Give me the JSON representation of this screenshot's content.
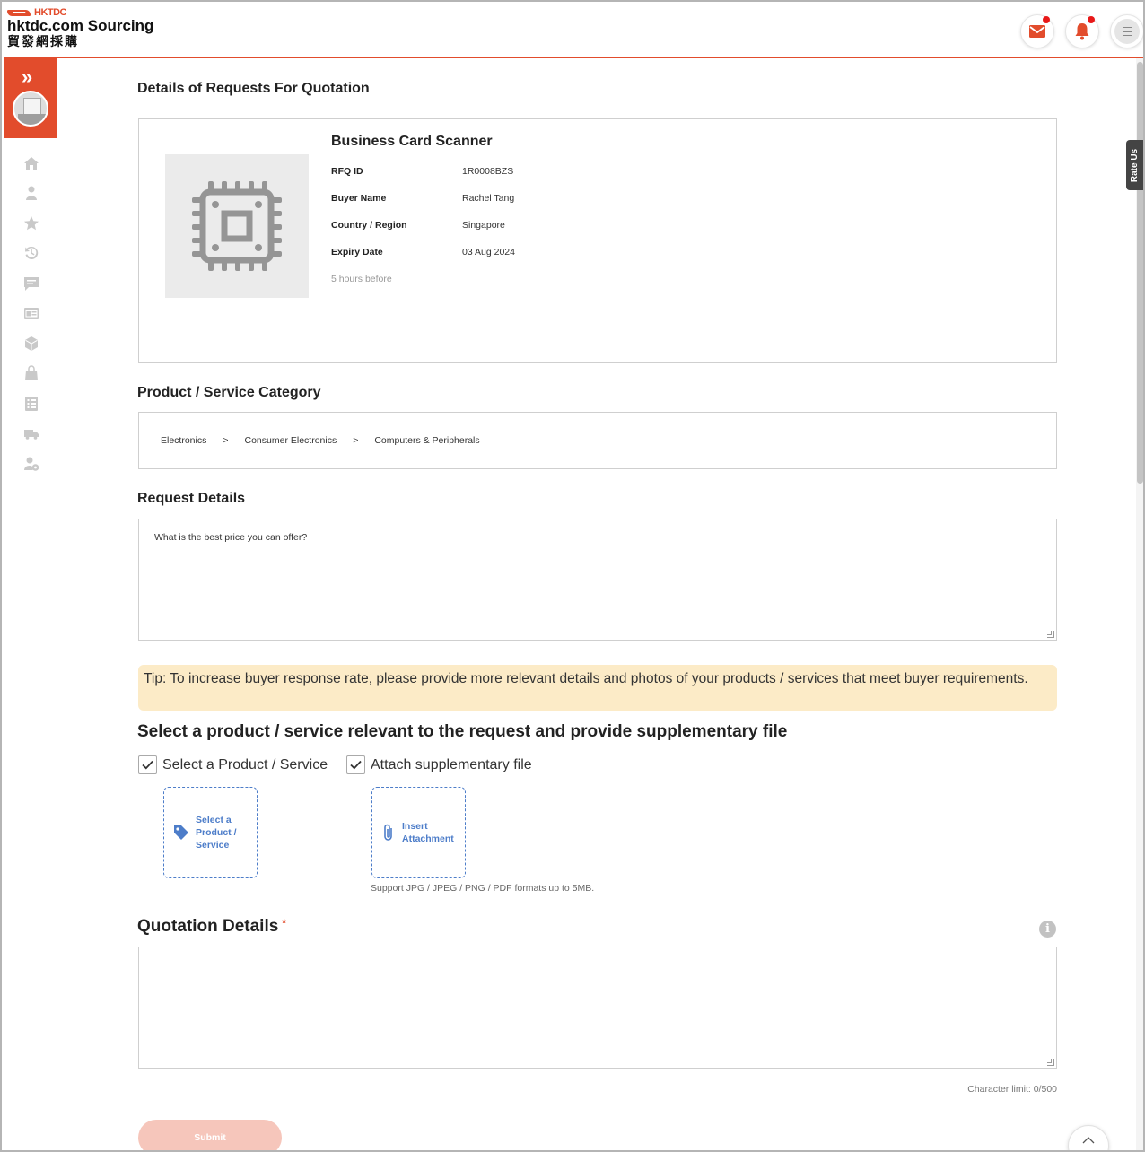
{
  "header": {
    "brand_small": "HKTDC",
    "brand_main": "hktdc.com Sourcing",
    "brand_cn": "貿發網採購"
  },
  "rate_us": "Rate Us",
  "page_title": "Details of Requests For Quotation",
  "rfq": {
    "product_name": "Business Card Scanner",
    "fields": [
      {
        "label": "RFQ ID",
        "value": "1R0008BZS"
      },
      {
        "label": "Buyer Name",
        "value": "Rachel Tang"
      },
      {
        "label": "Country / Region",
        "value": "Singapore"
      },
      {
        "label": "Expiry Date",
        "value": "03 Aug 2024"
      }
    ],
    "posted_ago": "5 hours before"
  },
  "category": {
    "title": "Product / Service Category",
    "path": [
      "Electronics",
      "Consumer Electronics",
      "Computers & Peripherals"
    ],
    "separator": ">"
  },
  "request": {
    "title": "Request Details",
    "text": "What is the best price you can offer?"
  },
  "tip": "Tip: To increase buyer response rate, please provide more relevant details and photos of your products / services that meet buyer requirements.",
  "supplementary": {
    "title": "Select a product / service relevant to the request and provide supplementary file",
    "checkbox_product": "Select a Product / Service",
    "checkbox_attach": "Attach supplementary file",
    "product_checked": true,
    "attach_checked": true,
    "select_product_button": "Select a Product / Service",
    "insert_attachment_button": "Insert Attachment",
    "support_note": "Support JPG / JPEG / PNG / PDF formats up to 5MB."
  },
  "quotation": {
    "title": "Quotation Details",
    "required_mark": "*",
    "value": "",
    "char_limit": "Character limit: 0/500"
  },
  "submit_label": "Submit",
  "colors": {
    "brand": "#e24c2c",
    "link": "#4d7dc9",
    "tip_bg": "#fcebc7",
    "submit_disabled": "#f6c6bb"
  },
  "icons": {
    "header": [
      "mail-icon",
      "bell-icon",
      "menu-icon"
    ],
    "sidebar": [
      "home-icon",
      "user-icon",
      "star-icon",
      "history-icon",
      "message-icon",
      "browser-icon",
      "cube-icon",
      "bag-icon",
      "document-list-icon",
      "truck-icon",
      "user-settings-icon"
    ]
  }
}
